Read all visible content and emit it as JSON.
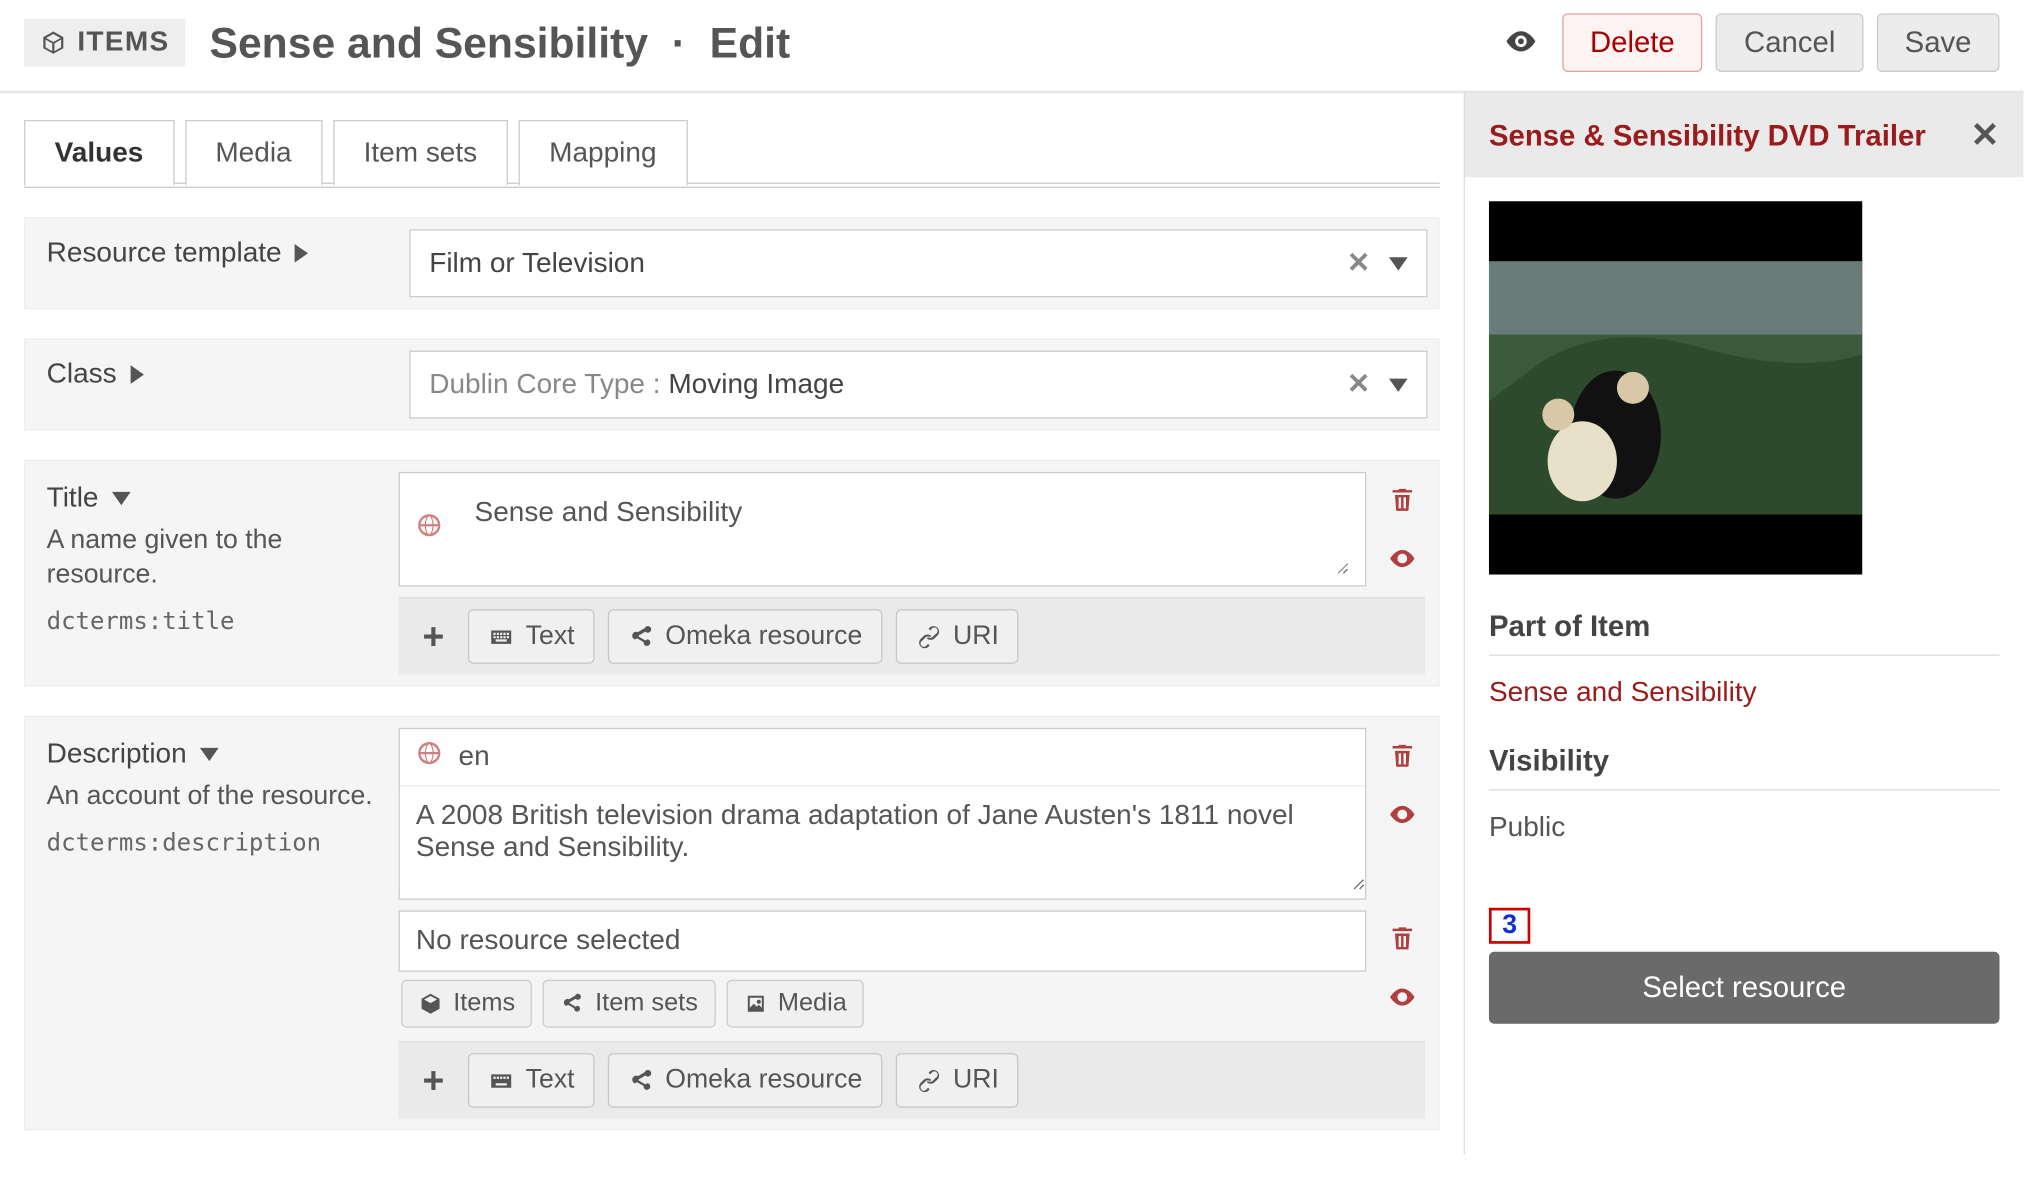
{
  "header": {
    "items_badge": "ITEMS",
    "title": "Sense and Sensibility",
    "separator": "·",
    "mode": "Edit",
    "buttons": {
      "delete": "Delete",
      "cancel": "Cancel",
      "save": "Save"
    }
  },
  "tabs": {
    "values": "Values",
    "media": "Media",
    "item_sets": "Item sets",
    "mapping": "Mapping"
  },
  "template_row": {
    "label": "Resource template",
    "value": "Film or Television"
  },
  "class_row": {
    "label": "Class",
    "prefix": "Dublin Core Type :",
    "value": "Moving Image"
  },
  "title_prop": {
    "label": "Title",
    "hint": "A name given to the resource.",
    "term": "dcterms:title",
    "value": "Sense and Sensibility"
  },
  "desc_prop": {
    "label": "Description",
    "hint": "An account of the resource.",
    "term": "dcterms:description",
    "lang": "en",
    "value": "A 2008 British television drama adaptation of Jane Austen's 1811 novel Sense and Sensibility.",
    "no_resource": "No resource selected"
  },
  "add_buttons": {
    "text": "Text",
    "omeka": "Omeka resource",
    "uri": "URI"
  },
  "resource_chips": {
    "items": "Items",
    "item_sets": "Item sets",
    "media": "Media"
  },
  "sidebar": {
    "title": "Sense & Sensibility DVD Trailer",
    "part_of_label": "Part of Item",
    "part_of_link": "Sense and Sensibility",
    "visibility_label": "Visibility",
    "visibility_value": "Public",
    "step": "3",
    "select_button": "Select resource"
  }
}
